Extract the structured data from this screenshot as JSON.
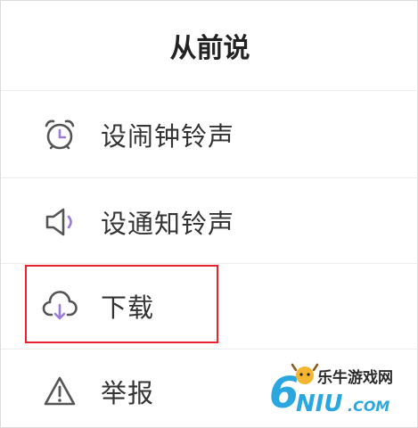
{
  "header": {
    "title": "从前说"
  },
  "menu": {
    "items": [
      {
        "label": "设闹钟铃声",
        "icon": "alarm-clock-icon"
      },
      {
        "label": "设通知铃声",
        "icon": "speaker-icon"
      },
      {
        "label": "下载",
        "icon": "cloud-download-icon"
      },
      {
        "label": "举报",
        "icon": "warning-icon"
      }
    ]
  },
  "watermark": {
    "text": "乐牛游戏网",
    "logo": "6NIU.COM"
  },
  "colors": {
    "accent": "#9c7bd9",
    "highlight": "#e8222e",
    "text": "#333333",
    "icon": "#555555"
  }
}
